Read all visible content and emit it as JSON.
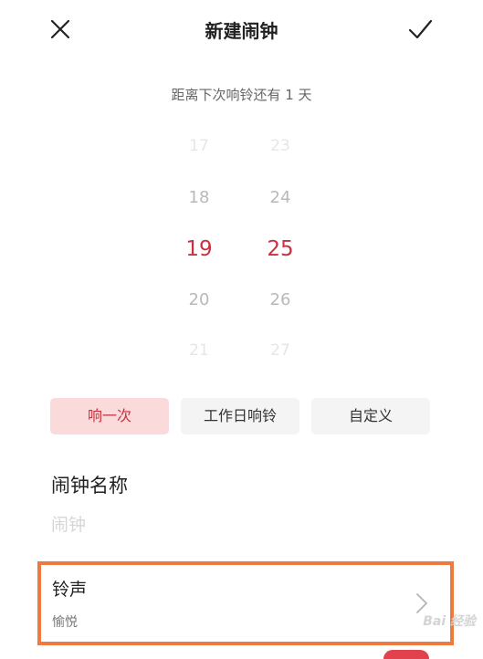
{
  "header": {
    "title": "新建闹钟",
    "close_icon": "close-icon",
    "confirm_icon": "check-icon"
  },
  "countdown": "距离下次响铃还有 1 天",
  "time_picker": {
    "hours": [
      "17",
      "18",
      "19",
      "20",
      "21"
    ],
    "minutes": [
      "23",
      "24",
      "25",
      "26",
      "27"
    ],
    "selected_hour": "19",
    "selected_minute": "25"
  },
  "repeat": {
    "options": [
      "响一次",
      "工作日响铃",
      "自定义"
    ],
    "selected": "响一次"
  },
  "alarm_name": {
    "label": "闹钟名称",
    "placeholder": "闹钟",
    "value": ""
  },
  "ringtone": {
    "label": "铃声",
    "value": "愉悦",
    "chevron_icon": "chevron-right-icon"
  },
  "watermark": "Bai 经验",
  "colors": {
    "accent": "#c8323e",
    "accent_bg": "#fbdadb",
    "highlight_border": "#ef7a3f"
  }
}
